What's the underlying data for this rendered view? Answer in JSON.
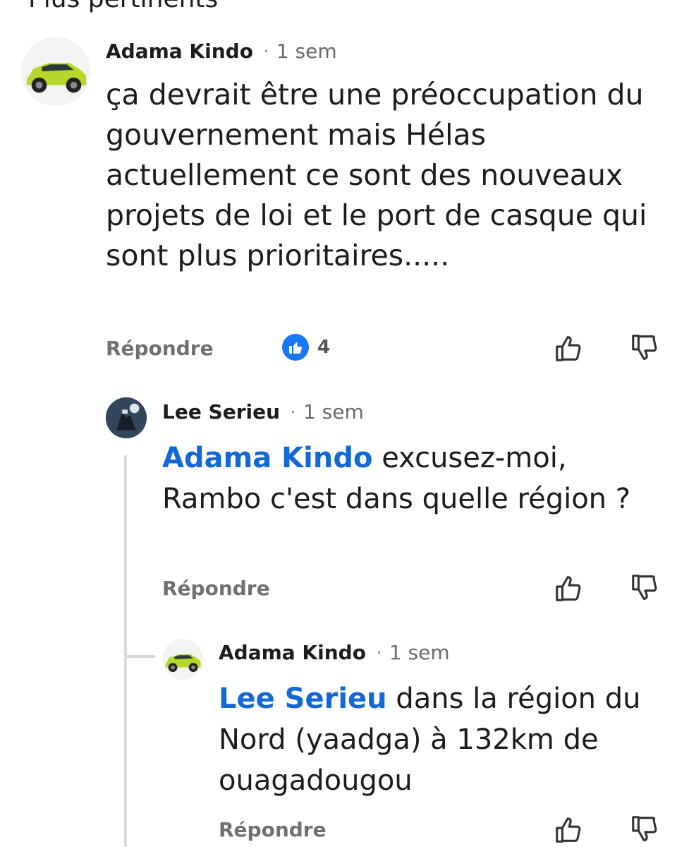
{
  "section": {
    "title": "Plus pertinents"
  },
  "comments": [
    {
      "author": "Adama Kindo",
      "separator": "·",
      "time": "1 sem",
      "text": "ça devrait être une préoccupation du gouvernement mais Hélas actuellement ce sont des nouveaux projets de loi et le port de casque qui sont plus prioritaires.....",
      "reply_label": "Répondre",
      "reaction_icon": "like-badge-icon",
      "reaction_count": "4",
      "avatar": "green-suv-avatar"
    },
    {
      "author": "Lee Serieu",
      "separator": "·",
      "time": "1 sem",
      "mention": "Adama Kindo",
      "text": " excusez-moi, Rambo c'est dans quelle région ?",
      "reply_label": "Répondre",
      "avatar": "dark-night-avatar"
    },
    {
      "author": "Adama Kindo",
      "separator": "·",
      "time": "1 sem",
      "mention": "Lee Serieu",
      "text": " dans la région du Nord (yaadga) à 132km de ouagadougou",
      "reply_label": "Répondre",
      "avatar": "green-suv-avatar"
    }
  ],
  "icons": {
    "like": "thumbs-up-icon",
    "dislike": "thumbs-down-icon"
  },
  "colors": {
    "mention": "#1367d6",
    "reaction": "#1877f2",
    "muted": "#707070"
  }
}
